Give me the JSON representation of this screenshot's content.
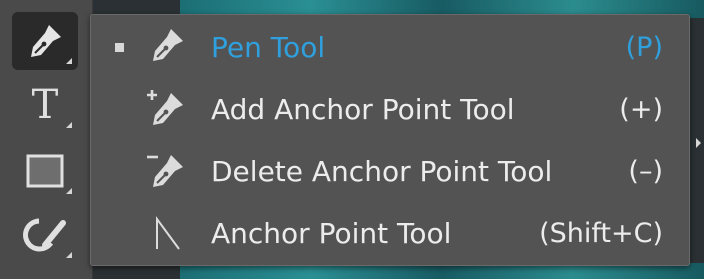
{
  "toolbar": {
    "tools": [
      {
        "name": "pen-tool",
        "icon": "pen-icon",
        "active": true
      },
      {
        "name": "type-tool",
        "icon": "type-icon",
        "glyph": "T"
      },
      {
        "name": "rectangle-tool",
        "icon": "rectangle-icon"
      },
      {
        "name": "shaper-tool",
        "icon": "shaper-icon"
      }
    ]
  },
  "flyout": {
    "items": [
      {
        "label": "Pen Tool",
        "shortcut": "(P)",
        "icon": "pen-icon",
        "selected": true
      },
      {
        "label": "Add Anchor Point Tool",
        "shortcut": "(+)",
        "icon": "add-anchor-point-icon",
        "selected": false
      },
      {
        "label": "Delete Anchor Point Tool",
        "shortcut": "(–)",
        "icon": "delete-anchor-point-icon",
        "selected": false
      },
      {
        "label": "Anchor Point Tool",
        "shortcut": "(Shift+C)",
        "icon": "anchor-point-icon",
        "selected": false
      }
    ]
  },
  "colors": {
    "selected_text": "#2fa0dd",
    "menu_text": "#ececec",
    "menu_bg": "#535353",
    "toolbar_bg": "#4a4a4a"
  }
}
